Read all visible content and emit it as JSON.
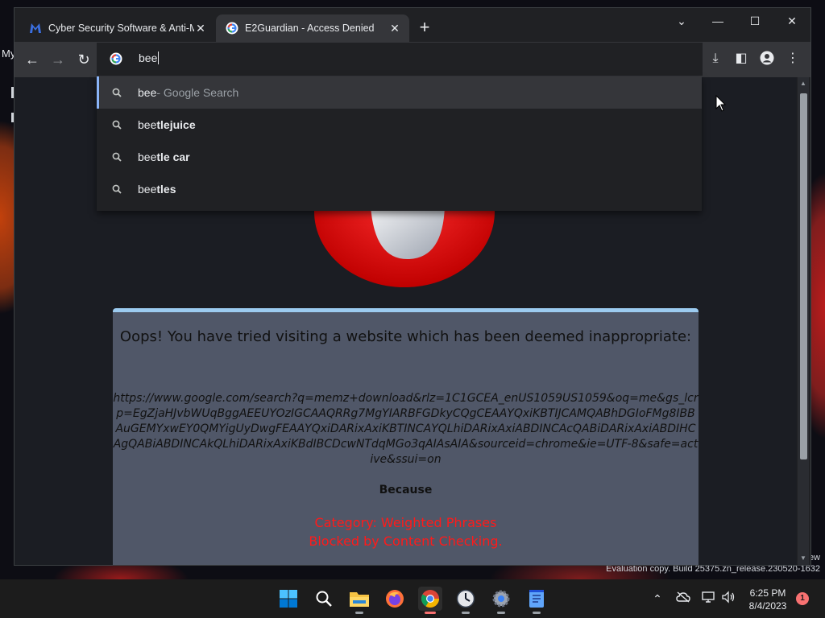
{
  "desktop": {
    "label_fragment": "My",
    "watermark": "Evaluation copy. Build 25375.zn_release.230520-1632",
    "watermark_fragment": "ew"
  },
  "browser": {
    "tabs": [
      {
        "title": "Cyber Security Software & Anti-M",
        "favicon": "malwarebytes-icon",
        "active": false
      },
      {
        "title": "E2Guardian - Access Denied",
        "favicon": "google-icon",
        "active": true
      }
    ],
    "omnibox": {
      "value": "bee"
    },
    "suggestions": [
      {
        "typed": "bee",
        "completion": "",
        "hint": " - Google Search",
        "selected": true
      },
      {
        "typed": "bee",
        "completion": "tlejuice",
        "hint": "",
        "selected": false
      },
      {
        "typed": "bee",
        "completion": "tle car",
        "hint": "",
        "selected": false
      },
      {
        "typed": "bee",
        "completion": "tles",
        "hint": "",
        "selected": false
      }
    ]
  },
  "page": {
    "heading": "Oops! You have tried visiting a website which has been deemed inappropriate:",
    "blocked_url": "https://www.google.com/search?q=memz+download&rlz=1C1GCEA_enUS1059US1059&oq=me&gs_lcrp=EgZjaHJvbWUqBggAEEUYOzIGCAAQRRg7MgYIARBFGDkyCQgCEAAYQxiKBTIJCAMQABhDGIoFMg8IBBAuGEMYxwEY0QMYigUyDwgFEAAYQxiDARixAxiKBTINCAYQLhiDARixAxiABDINCAcQABiDARixAxiABDIHCAgQABiABDINCAkQLhiDARixAxiKBdIBCDcwNTdqMGo3qAIAsAIA&sourceid=chrome&ie=UTF-8&safe=active&ssui=on",
    "because": "Because",
    "category": "Category: Weighted Phrases",
    "reason": "Blocked by Content Checking."
  },
  "taskbar": {
    "apps": [
      "start-icon",
      "search-icon",
      "file-explorer-icon",
      "firefox-icon",
      "chrome-icon",
      "clock-app-icon",
      "settings-icon",
      "notepad-icon"
    ],
    "time": "6:25 PM",
    "date": "8/4/2023",
    "notifications": "1"
  },
  "colors": {
    "accent": "#8ab4f8",
    "blocked_reason": "#ff1a1a",
    "panel": "#505768"
  }
}
